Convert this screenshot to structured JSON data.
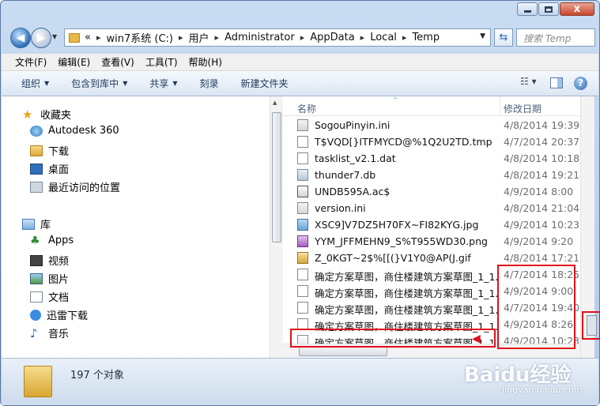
{
  "window": {
    "controls": {
      "minimize": "",
      "maximize": "",
      "close": "x"
    }
  },
  "address": {
    "overflow": "«",
    "crumbs": [
      "win7系统 (C:)",
      "用户",
      "Administrator",
      "AppData",
      "Local",
      "Temp"
    ],
    "search_placeholder": "搜索 Temp"
  },
  "menubar": {
    "file": "文件(F)",
    "edit": "编辑(E)",
    "view": "查看(V)",
    "tools": "工具(T)",
    "help": "帮助(H)"
  },
  "commands": {
    "organize": "组织",
    "include_in_library": "包含到库中",
    "share": "共享",
    "burn": "刻录",
    "new_folder": "新建文件夹"
  },
  "nav": {
    "favorites": "收藏夹",
    "autodesk": "Autodesk 360",
    "downloads": "下载",
    "desktop": "桌面",
    "recent": "最近访问的位置",
    "libraries": "库",
    "apps": "Apps",
    "videos": "视频",
    "pictures": "图片",
    "documents": "文档",
    "thunder": "迅雷下载",
    "music": "音乐"
  },
  "columns": {
    "name": "名称",
    "modified": "修改日期"
  },
  "files": [
    {
      "name": "SogouPinyin.ini",
      "date": "4/8/2014 19:39",
      "icon": "ini"
    },
    {
      "name": "T$VQD[}ITFMYCD@%1Q2U2TD.tmp",
      "date": "4/7/2014 20:37",
      "icon": "file"
    },
    {
      "name": "tasklist_v2.1.dat",
      "date": "4/8/2014 10:18",
      "icon": "file"
    },
    {
      "name": "thunder7.db",
      "date": "4/8/2014 19:21",
      "icon": "db"
    },
    {
      "name": "UNDB595A.ac$",
      "date": "4/9/2014 8:00",
      "icon": "ac"
    },
    {
      "name": "version.ini",
      "date": "4/8/2014 21:04",
      "icon": "ini"
    },
    {
      "name": "XSC9]V7DZ5H70FX~FI82KYG.jpg",
      "date": "4/9/2014 10:23",
      "icon": "jpg"
    },
    {
      "name": "YYM_JFFMEHN9_S%T955WD30.png",
      "date": "4/9/2014 9:20",
      "icon": "png"
    },
    {
      "name": "Z_0KGT~2$%[[(}V1Y0@AP(J.gif",
      "date": "4/8/2014 17:21",
      "icon": "gif"
    },
    {
      "name": "确定方案草图，商住楼建筑方案草图_1_1...",
      "date": "4/7/2014 18:25",
      "icon": "file"
    },
    {
      "name": "确定方案草图，商住楼建筑方案草图_1_1...",
      "date": "4/9/2014 9:00",
      "icon": "file"
    },
    {
      "name": "确定方案草图，商住楼建筑方案草图_1_1...",
      "date": "4/7/2014 19:40",
      "icon": "file"
    },
    {
      "name": "确定方案草图，商住楼建筑方案草图_1_1...",
      "date": "4/9/2014 8:26",
      "icon": "file"
    },
    {
      "name": "确定方案草图，商住楼建筑方案草图_1_1...",
      "date": "4/9/2014 10:23",
      "icon": "dwg"
    }
  ],
  "status": {
    "count": "197 个对象"
  },
  "watermark": {
    "brand": "Baidu经验",
    "url": "jingyan.baidu.com"
  }
}
